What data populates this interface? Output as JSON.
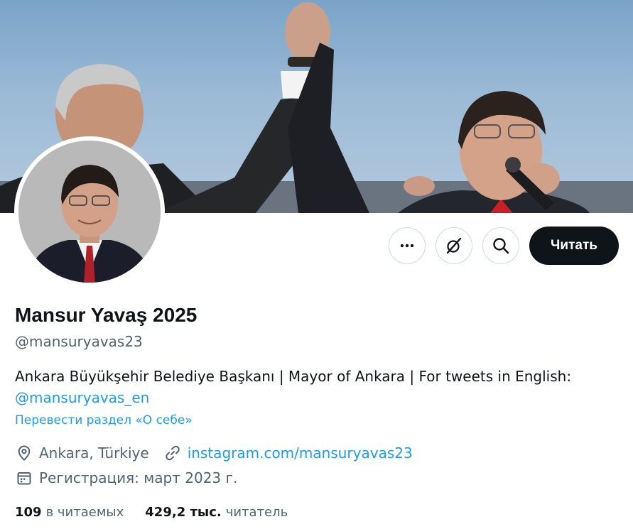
{
  "profile": {
    "display_name": "Mansur Yavaş 2025",
    "handle": "@mansuryavas23",
    "bio_text": "Ankara Büyükşehir Belediye Başkanı | Mayor of Ankara | For tweets in English:",
    "bio_mention": "@mansuryavas_en",
    "translate_bio": "Перевести раздел «О себе»",
    "location": "Ankara, Türkiye",
    "website": "instagram.com/mansuryavas23",
    "joined": "Регистрация: март 2023 г."
  },
  "actions": {
    "more_icon": "more-horizontal-icon",
    "grok_icon": "grok-slash-icon",
    "search_icon": "search-icon",
    "follow_label": "Читать"
  },
  "stats": {
    "following_count": "109",
    "following_label": "в читаемых",
    "followers_count": "429,2 тыс.",
    "followers_label": "читатель"
  },
  "colors": {
    "accent": "#1d9bf0",
    "text": "#0f1419",
    "muted": "#536471",
    "border": "#cfd9de"
  }
}
